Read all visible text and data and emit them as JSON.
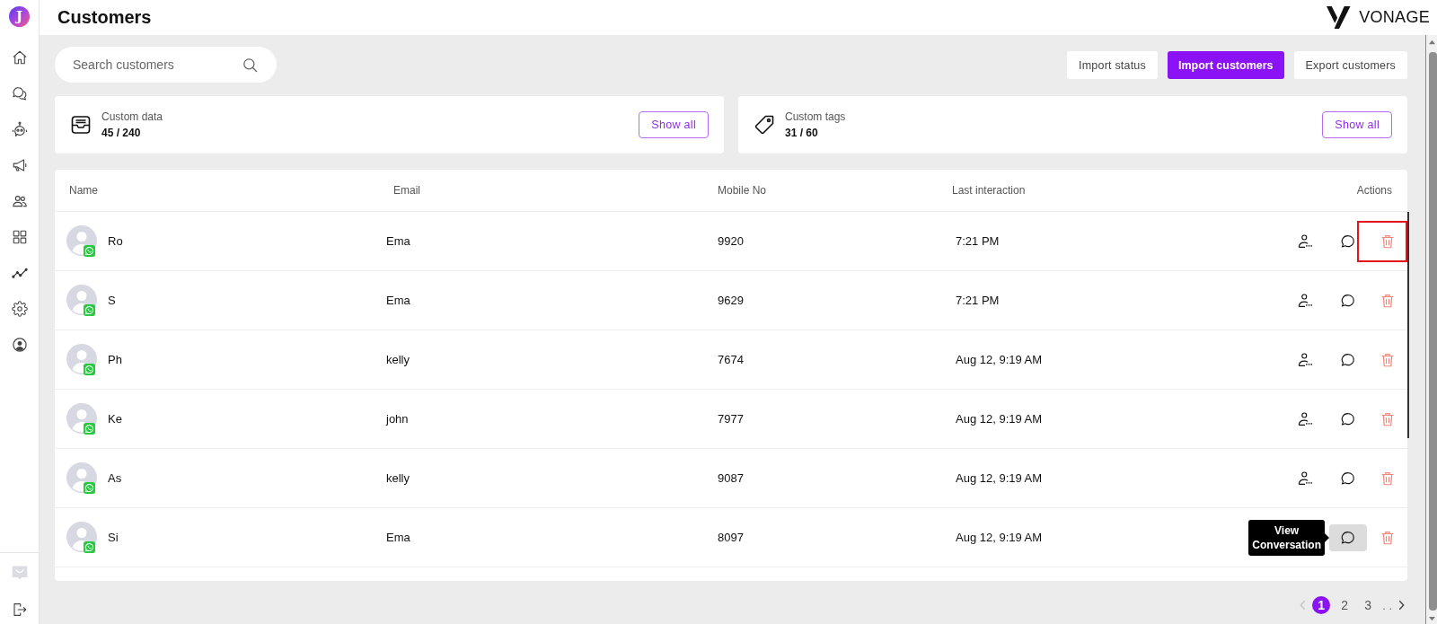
{
  "sidebar": {
    "logo": "J"
  },
  "header": {
    "title": "Customers",
    "brand": "VONAGE"
  },
  "search": {
    "placeholder": "Search customers"
  },
  "buttons": [
    {
      "label": "Import status",
      "kind": "secondary"
    },
    {
      "label": "Import customers",
      "kind": "primary"
    },
    {
      "label": "Export customers",
      "kind": "secondary"
    }
  ],
  "summary_cards": [
    {
      "kind": "data",
      "label": "Custom data",
      "value": "45 / 240",
      "button": "Show all"
    },
    {
      "kind": "tags",
      "label": "Custom tags",
      "value": "31 / 60",
      "button": "Show all"
    }
  ],
  "table": {
    "columns": [
      "Name",
      "Email",
      "Mobile No",
      "Last interaction",
      "Actions"
    ],
    "rows": [
      {
        "name": "Ro",
        "email": "Ema",
        "mobile": "9920",
        "last_interaction": "7:21 PM",
        "chat_hovered": false,
        "delete_highlighted": true
      },
      {
        "name": "S",
        "email": "Ema",
        "mobile": "9629",
        "last_interaction": "7:21 PM",
        "chat_hovered": false,
        "delete_highlighted": false
      },
      {
        "name": "Ph",
        "email": "kelly",
        "mobile": "7674",
        "last_interaction": "Aug 12, 9:19 AM",
        "chat_hovered": false,
        "delete_highlighted": false
      },
      {
        "name": "Ke",
        "email": "john",
        "mobile": "7977",
        "last_interaction": "Aug 12, 9:19 AM",
        "chat_hovered": false,
        "delete_highlighted": false
      },
      {
        "name": "As",
        "email": "kelly",
        "mobile": "9087",
        "last_interaction": "Aug 12, 9:19 AM",
        "chat_hovered": false,
        "delete_highlighted": false
      },
      {
        "name": "Si",
        "email": "Ema",
        "mobile": "8097",
        "last_interaction": "Aug 12, 9:19 AM",
        "chat_hovered": true,
        "tooltip": "View Conversation",
        "delete_highlighted": false
      }
    ]
  },
  "pagination": {
    "prev_disabled": true,
    "pages": [
      {
        "label": "1",
        "selected": true
      },
      {
        "label": "2",
        "selected": false
      },
      {
        "label": "3",
        "selected": false
      }
    ],
    "more": ". ."
  }
}
